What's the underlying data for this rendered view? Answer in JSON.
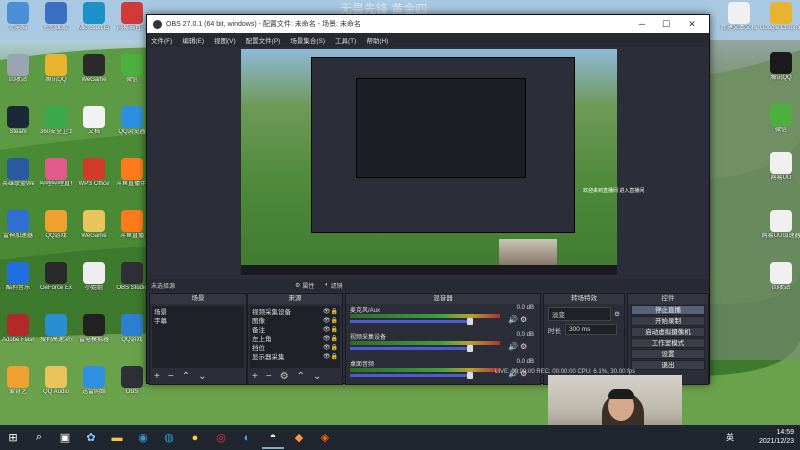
{
  "desktop": {
    "faded_title": "无畏先锋 黄金四",
    "left_icons": [
      {
        "label": "此电脑",
        "icon": "pc-icon",
        "color": "#4a8fd6"
      },
      {
        "label": "控制面板",
        "icon": "control-panel-icon",
        "color": "#3a6fc1"
      },
      {
        "label": "Microsoft Edge",
        "icon": "edge-icon",
        "color": "#1e90c8"
      },
      {
        "label": "网易云音乐",
        "icon": "netease-music-icon",
        "color": "#d23a3a"
      },
      {
        "label": "回收站",
        "icon": "recycle-bin-icon",
        "color": "#9aa5b3"
      },
      {
        "label": "腾讯QQ",
        "icon": "qq-icon",
        "color": "#e8b32f"
      },
      {
        "label": "WeGame",
        "icon": "wegame-icon",
        "color": "#2a2a2a"
      },
      {
        "label": "微信",
        "icon": "wechat-icon",
        "color": "#4bb13c"
      },
      {
        "label": "Steam",
        "icon": "steam-icon",
        "color": "#1b2838"
      },
      {
        "label": "360安全卫士",
        "icon": "360-icon",
        "color": "#3aa94a"
      },
      {
        "label": "文档",
        "icon": "document-icon",
        "color": "#f2f2f2"
      },
      {
        "label": "QQ浏览器",
        "icon": "qq-browser-icon",
        "color": "#2f8fdf"
      },
      {
        "label": "英雄联盟WeGame版",
        "icon": "lol-icon",
        "color": "#2b5aa3"
      },
      {
        "label": "哔哩哔哩直播姬",
        "icon": "bilibili-icon",
        "color": "#e05a8a"
      },
      {
        "label": "WPS Office",
        "icon": "wps-icon",
        "color": "#d23a2a"
      },
      {
        "label": "斗鱼直播伴侣",
        "icon": "douyu-icon",
        "color": "#ff7a1a"
      },
      {
        "label": "雷神加速器",
        "icon": "thunder-icon",
        "color": "#2f6fd1"
      },
      {
        "label": "QQ游戏",
        "icon": "qq-game-icon",
        "color": "#f0a030"
      },
      {
        "label": "WeGame",
        "icon": "folder-icon",
        "color": "#e8c45a"
      },
      {
        "label": "斗鱼直播",
        "icon": "douyu-live-icon",
        "color": "#ff7a1a"
      },
      {
        "label": "酷狗音乐",
        "icon": "kugou-icon",
        "color": "#1f6fe0"
      },
      {
        "label": "GeForce Experience",
        "icon": "nvidia-icon",
        "color": "#2a2a2a"
      },
      {
        "label": "小姐姐",
        "icon": "person-icon",
        "color": "#eeeeee"
      },
      {
        "label": "OBS Studio",
        "icon": "obs-icon",
        "color": "#302f35"
      },
      {
        "label": "Adobe Flash",
        "icon": "flash-icon",
        "color": "#b02a2a"
      },
      {
        "label": "搜狗高速浏览器",
        "icon": "sogou-icon",
        "color": "#2a8fd0"
      },
      {
        "label": "雷电模拟器",
        "icon": "emulator-icon",
        "color": "#222222"
      },
      {
        "label": "QQ游戏",
        "icon": "qq-game2-icon",
        "color": "#2f7fd0"
      },
      {
        "label": "爱奇艺",
        "icon": "iqiyi-icon",
        "color": "#f0a030"
      },
      {
        "label": "QQ Audio",
        "icon": "folder2-icon",
        "color": "#e8c45a"
      },
      {
        "label": "迅雷网络",
        "icon": "xunlei-icon",
        "color": "#2f8fe0"
      },
      {
        "label": "OBS",
        "icon": "obs2-icon",
        "color": "#302f35"
      }
    ],
    "right_icons": [
      {
        "label": "新建文本文档",
        "icon": "text-file-icon",
        "color": "#f0f0f0"
      },
      {
        "label": "Google Chrome",
        "icon": "chrome-icon",
        "color": "#e8b32f"
      },
      {
        "label": "腾讯QQ",
        "icon": "qq-right-icon",
        "color": "#1a1a1a"
      },
      {
        "label": "微信",
        "icon": "wechat-right-icon",
        "color": "#4bb13c"
      },
      {
        "label": "网易UU",
        "icon": "file-right-icon",
        "color": "#f0f0f0"
      },
      {
        "label": "网易UU加速器",
        "icon": "file-right2-icon",
        "color": "#f0f0f0"
      },
      {
        "label": "回收站",
        "icon": "file-right3-icon",
        "color": "#f0f0f0"
      }
    ]
  },
  "obs": {
    "title": "OBS 27.0.1 (64 bit, windows) - 配置文件: 未命名 - 场景: 未命名",
    "menus": [
      "文件(F)",
      "编辑(E)",
      "视图(V)",
      "配置文件(P)",
      "场景集合(S)",
      "工具(T)",
      "帮助(H)"
    ],
    "scene_label": "未选择源",
    "properties_btn": "属性",
    "filters_btn": "滤镜",
    "preview_caption": "欢迎来到直播间 进入直播间",
    "docks": {
      "scenes": {
        "title": "场景",
        "items": [
          "场景",
          "字幕"
        ]
      },
      "sources": {
        "title": "来源",
        "items": [
          "视频采集设备",
          "图像",
          "备注",
          "左上角",
          "挡位",
          "显示器采集"
        ]
      },
      "mixer": {
        "title": "混音器",
        "channels": [
          {
            "name": "麦克风/Aux",
            "db": "0.0 dB",
            "level": 0.8
          },
          {
            "name": "视频采集设备",
            "db": "0.0 dB",
            "level": 0.8
          },
          {
            "name": "桌面音频",
            "db": "0.0 dB",
            "level": 0.8
          }
        ]
      },
      "transitions": {
        "title": "转场特效",
        "type": "淡变",
        "duration_label": "时长",
        "duration": "300 ms"
      },
      "controls": {
        "title": "控件",
        "buttons": [
          "停止直播",
          "开始录制",
          "启动虚拟摄像机",
          "工作室模式",
          "设置",
          "退出"
        ]
      }
    },
    "status": "LIVE: 00:00:00   REC: 00:00:00   CPU: 6.1%, 30.00 fps"
  },
  "taskbar": {
    "time": "14:59",
    "date": "2021/12/23",
    "lang": "英"
  }
}
